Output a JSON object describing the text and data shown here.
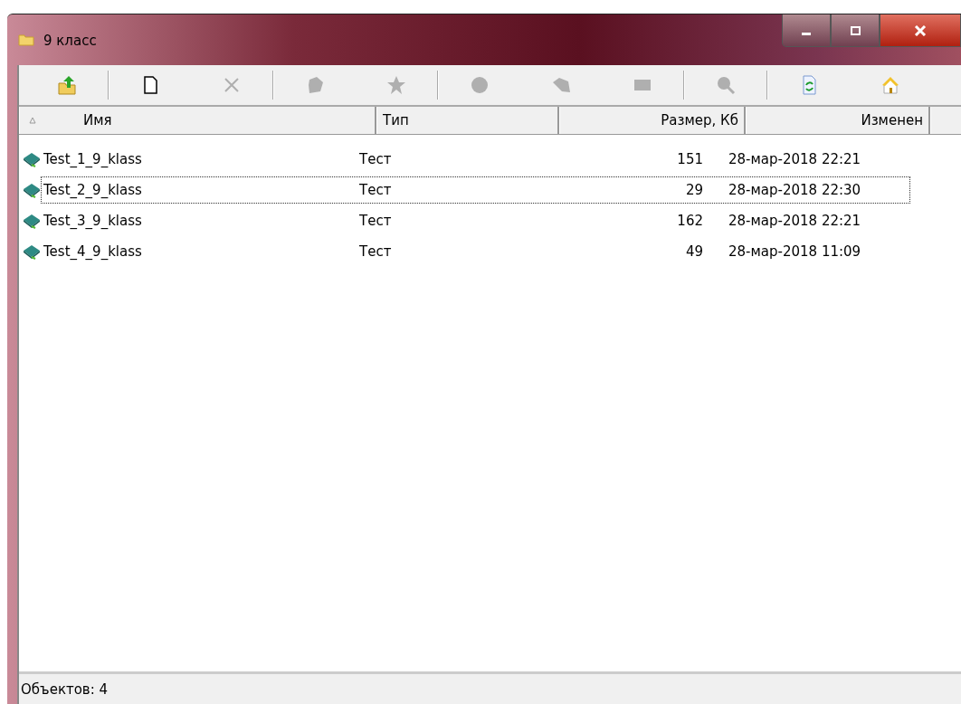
{
  "window": {
    "title": "9 класс"
  },
  "toolbar": [
    {
      "kind": "up",
      "disabled": false
    },
    {
      "kind": "separator"
    },
    {
      "kind": "new",
      "disabled": false
    },
    {
      "kind": "delete",
      "disabled": true
    },
    {
      "kind": "separator"
    },
    {
      "kind": "blob",
      "disabled": true
    },
    {
      "kind": "star",
      "disabled": true
    },
    {
      "kind": "separator"
    },
    {
      "kind": "play",
      "disabled": true
    },
    {
      "kind": "tag",
      "disabled": true
    },
    {
      "kind": "rect",
      "disabled": true
    },
    {
      "kind": "separator"
    },
    {
      "kind": "search",
      "disabled": true
    },
    {
      "kind": "separator"
    },
    {
      "kind": "refresh",
      "disabled": false
    },
    {
      "kind": "home",
      "disabled": false
    }
  ],
  "table": {
    "columns": [
      {
        "label": "Имя",
        "sorted": true
      },
      {
        "label": "Тип",
        "sorted": false
      },
      {
        "label": "Размер, Кб",
        "sorted": false
      },
      {
        "label": "Изменен",
        "sorted": false
      }
    ],
    "rows": [
      {
        "name": "Test_1_9_klass",
        "type": "Тест",
        "size": "151",
        "modified": "28-мар-2018 22:21",
        "focused": false
      },
      {
        "name": "Test_2_9_klass",
        "type": "Тест",
        "size": "29",
        "modified": "28-мар-2018 22:30",
        "focused": true
      },
      {
        "name": "Test_3_9_klass",
        "type": "Тест",
        "size": "162",
        "modified": "28-мар-2018 22:21",
        "focused": false
      },
      {
        "name": "Test_4_9_klass",
        "type": "Тест",
        "size": "49",
        "modified": "28-мар-2018 11:09",
        "focused": false
      }
    ]
  },
  "status_bar": {
    "text": "Объектов: 4"
  }
}
